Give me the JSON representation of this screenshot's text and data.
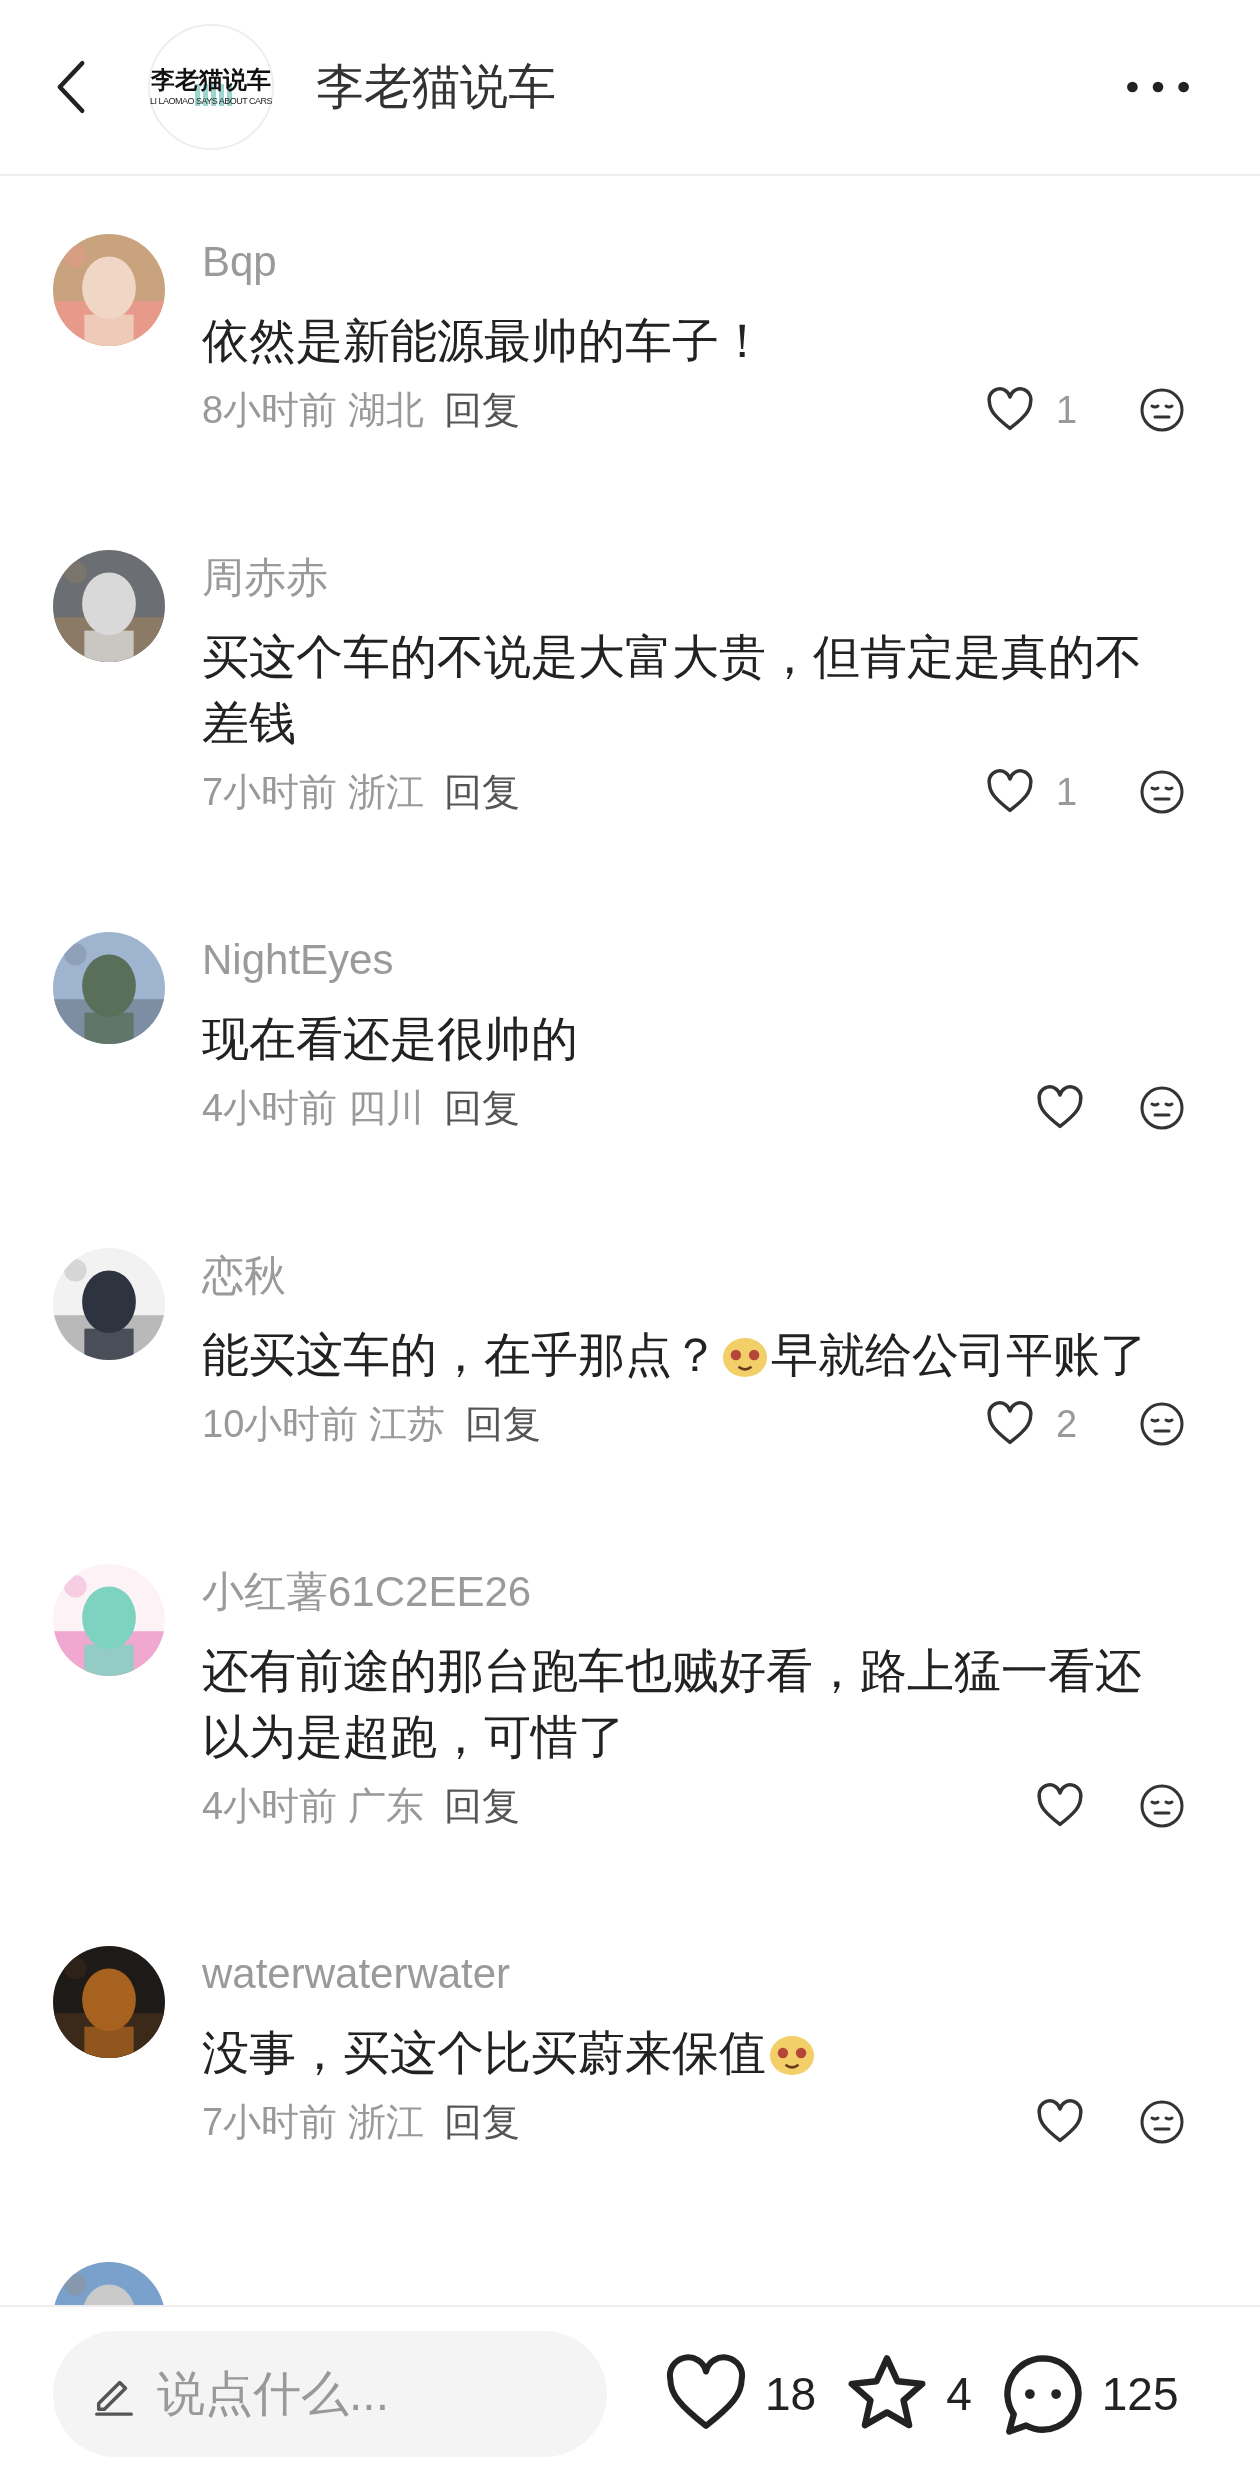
{
  "header": {
    "logo": {
      "title": "李老猫说车",
      "subtitle": "LI LAOMAO SAYS ABOUT CARS"
    },
    "title": "李老猫说车"
  },
  "comments": [
    {
      "name": "Bqp",
      "segments": [
        {
          "kind": "text",
          "text": "依然是新能源最帅的车子！"
        }
      ],
      "time": "8小时前",
      "region": "湖北",
      "reply": "回复",
      "likes": "1"
    },
    {
      "name": "周赤赤",
      "segments": [
        {
          "kind": "text",
          "text": "买这个车的不说是大富大贵，但肯定是真的不差钱"
        }
      ],
      "time": "7小时前",
      "region": "浙江",
      "reply": "回复",
      "likes": "1"
    },
    {
      "name": "NightEyes",
      "segments": [
        {
          "kind": "text",
          "text": "现在看还是很帅的"
        }
      ],
      "time": "4小时前",
      "region": "四川",
      "reply": "回复"
    },
    {
      "name": "恋秋",
      "segments": [
        {
          "kind": "text",
          "text": "能买这车的，在乎那点？"
        },
        {
          "kind": "emoji"
        },
        {
          "kind": "text",
          "text": "早就给公司平账了"
        }
      ],
      "time": "10小时前",
      "region": "江苏",
      "reply": "回复",
      "likes": "2"
    },
    {
      "name": "小红薯61C2EE26",
      "segments": [
        {
          "kind": "text",
          "text": "还有前途的那台跑车也贼好看，路上猛一看还以为是超跑，可惜了"
        }
      ],
      "time": "4小时前",
      "region": "广东",
      "reply": "回复"
    },
    {
      "name": "waterwaterwater",
      "segments": [
        {
          "kind": "text",
          "text": "没事，买这个比买蔚来保值"
        },
        {
          "kind": "emoji"
        }
      ],
      "time": "7小时前",
      "region": "浙江",
      "reply": "回复"
    }
  ],
  "bottom_bar": {
    "placeholder": "说点什么...",
    "likes": "18",
    "favorites": "4",
    "comments": "125"
  }
}
